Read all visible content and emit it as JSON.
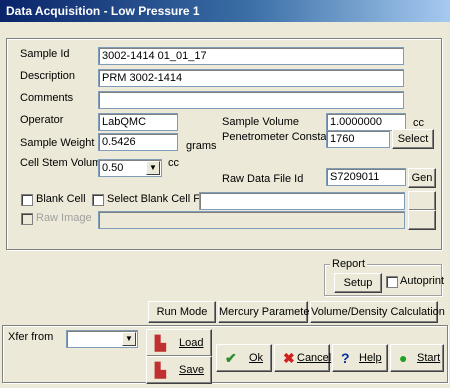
{
  "window": {
    "title": "Data Acquisition - Low Pressure 1"
  },
  "form": {
    "sample_id": {
      "label": "Sample Id",
      "value": "3002-1414 01_01_17"
    },
    "description": {
      "label": "Description",
      "value": "PRM 3002-1414"
    },
    "comments": {
      "label": "Comments",
      "value": ""
    },
    "operator": {
      "label": "Operator",
      "value": "LabQMC"
    },
    "sample_weight": {
      "label": "Sample Weight",
      "value": "0.5426",
      "unit": "grams"
    },
    "cell_stem_volume": {
      "label": "Cell Stem Volume",
      "value": "0.50",
      "unit": "cc"
    },
    "sample_volume": {
      "label": "Sample Volume",
      "value": "1.0000000",
      "unit": "cc"
    },
    "penetrometer_constant": {
      "label": "Penetrometer Constant",
      "value": "1760",
      "button": "Select"
    },
    "raw_data_file_id": {
      "label": "Raw Data File Id",
      "value": "S7209011",
      "button": "Gen"
    },
    "blank_cell": {
      "label": "Blank Cell"
    },
    "select_blank_cell_file": {
      "label": "Select Blank Cell File",
      "value": ""
    },
    "raw_image": {
      "label": "Raw Image",
      "value": ""
    }
  },
  "report": {
    "label": "Report",
    "setup": "Setup",
    "autoprint": "Autoprint"
  },
  "buttons": {
    "run_mode": "Run Mode",
    "mercury_parameters": "Mercury Parameters",
    "volume_density": "Volume/Density Calculation",
    "load": "Load",
    "save": "Save",
    "ok": "Ok",
    "cancel": "Cancel",
    "help": "Help",
    "start": "Start"
  },
  "xfer": {
    "label": "Xfer from",
    "value": ""
  },
  "colors": {
    "title_start": "#0a246a",
    "title_end": "#a6caf0",
    "face": "#ece9d8"
  }
}
